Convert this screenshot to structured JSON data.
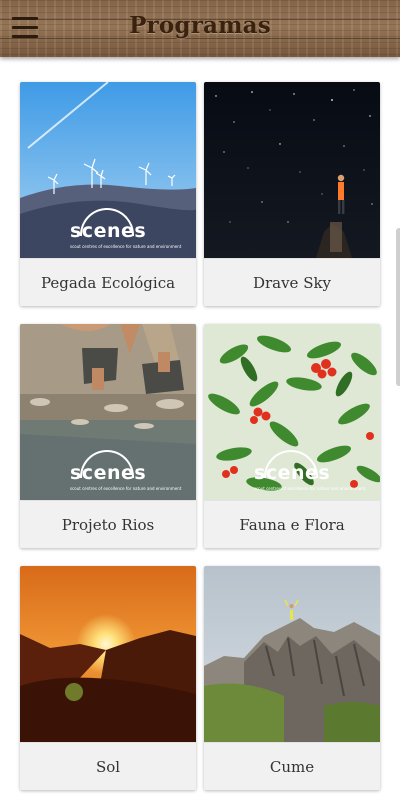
{
  "header": {
    "title": "Programas",
    "menu_icon": "hamburger-menu-icon",
    "bar_color": "#8f6f51",
    "title_color": "#3a220f"
  },
  "logo": {
    "word": "scenes",
    "tagline": "scout centres of excellence for nature and environment"
  },
  "programs": [
    {
      "label": "Pegada Ecológica",
      "image": "wind turbines on a mountain ridge",
      "has_logo": true
    },
    {
      "label": "Drave Sky",
      "image": "person under a starry night sky",
      "has_logo": false
    },
    {
      "label": "Projeto Rios",
      "image": "crouching hiker by a shallow river",
      "has_logo": true
    },
    {
      "label": "Fauna e Flora",
      "image": "strawberry tree with red berries",
      "has_logo": true
    },
    {
      "label": "Sol",
      "image": "sunset between mountains",
      "has_logo": false
    },
    {
      "label": "Cume",
      "image": "person standing on a rocky summit",
      "has_logo": false
    }
  ],
  "colors": {
    "card_background": "#f1f1f1",
    "card_label_text": "#333333"
  }
}
